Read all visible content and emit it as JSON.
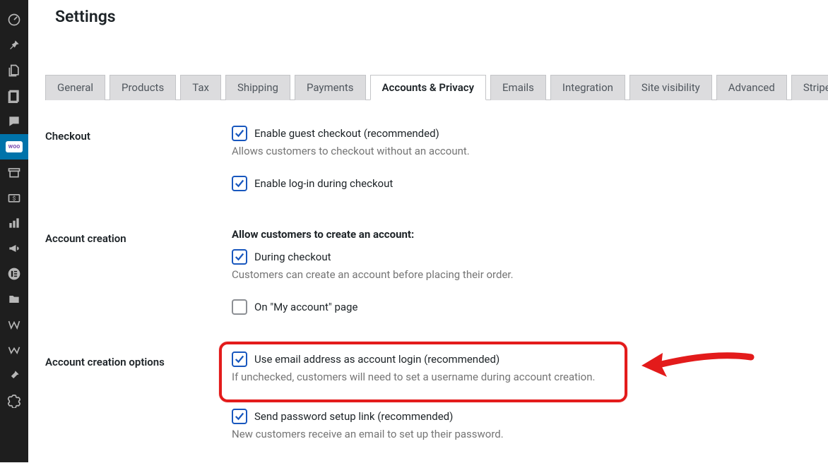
{
  "page": {
    "title": "Settings"
  },
  "tabs": {
    "items": [
      "General",
      "Products",
      "Tax",
      "Shipping",
      "Payments",
      "Accounts & Privacy",
      "Emails",
      "Integration",
      "Site visibility",
      "Advanced",
      "Stripe"
    ]
  },
  "sections": {
    "checkout": {
      "label": "Checkout",
      "guest_checkbox_label": "Enable guest checkout (recommended)",
      "guest_desc": "Allows customers to checkout without an account.",
      "login_checkbox_label": "Enable log-in during checkout"
    },
    "creation": {
      "label": "Account creation",
      "heading": "Allow customers to create an account:",
      "during_checkout_label": "During checkout",
      "during_checkout_desc": "Customers can create an account before placing their order.",
      "my_account_label": "On \"My account\" page"
    },
    "options": {
      "label": "Account creation options",
      "use_email_label": "Use email address as account login (recommended)",
      "use_email_desc": "If unchecked, customers will need to set a username during account creation.",
      "send_link_label": "Send password setup link (recommended)",
      "send_link_desc": "New customers receive an email to set up their password."
    }
  },
  "sidebar_icons": [
    "dashboard-icon",
    "pin-icon",
    "media-icon",
    "pages-icon",
    "comments-icon",
    "woocommerce-icon",
    "archive-icon",
    "currency-icon",
    "analytics-icon",
    "marketing-icon",
    "elementor-icon",
    "templates-icon",
    "w-icon",
    "w2-icon",
    "tools-icon",
    "settings-icon"
  ],
  "colors": {
    "check": "#1857be",
    "highlight": "#e31b1b",
    "accent": "#0073aa"
  }
}
